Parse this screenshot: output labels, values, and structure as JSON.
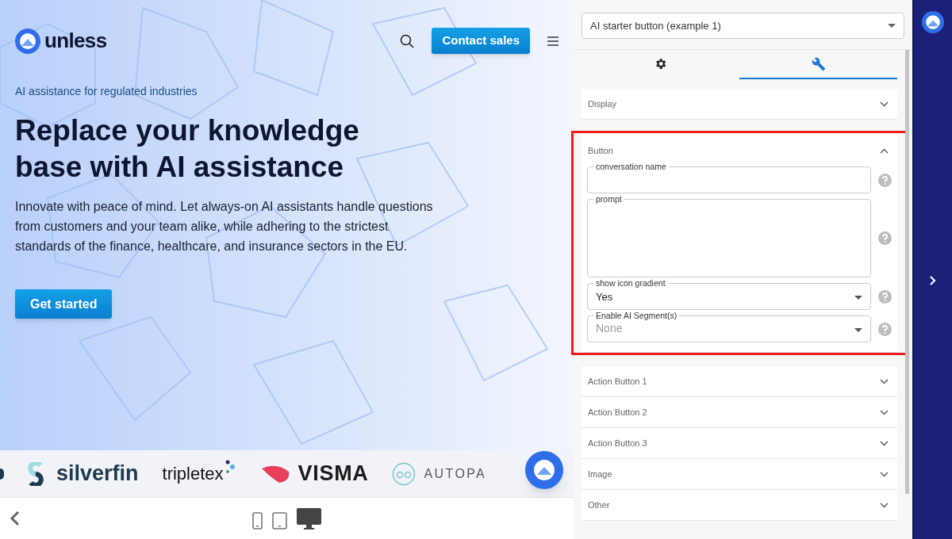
{
  "preview": {
    "logo": "unless",
    "contact_button": "Contact sales",
    "eyebrow": "AI assistance for regulated industries",
    "headline": "Replace your knowledge base with AI assistance",
    "body": "Innovate with peace of mind. Let always-on AI assistants handle questions from customers and your team alike, while adhering to the strictest standards of the finance, healthcare, and insurance sectors in the EU.",
    "cta": "Get started",
    "logos": [
      {
        "kind": "silverfin",
        "text": "silverfin"
      },
      {
        "kind": "tripletex",
        "text": "tripletex"
      },
      {
        "kind": "visma",
        "text": "VISMA"
      },
      {
        "kind": "autopay",
        "text": "AUTOPA"
      }
    ]
  },
  "device_bar": {
    "devices": [
      {
        "kind": "phone",
        "selected": false
      },
      {
        "kind": "tablet",
        "selected": false
      },
      {
        "kind": "desktop",
        "selected": true
      }
    ]
  },
  "editor": {
    "component_select": "AI starter button (example 1)",
    "tabs": [
      {
        "kind": "settings",
        "selected": false
      },
      {
        "kind": "style",
        "selected": true
      }
    ],
    "sections": [
      {
        "title": "Display",
        "expanded": false,
        "highlighted": false
      },
      {
        "title": "Button",
        "expanded": true,
        "highlighted": true,
        "fields": [
          {
            "kind": "text",
            "label": "conversation name"
          },
          {
            "kind": "textarea",
            "label": "prompt"
          },
          {
            "kind": "select",
            "label": "show icon gradient",
            "value": "Yes"
          },
          {
            "kind": "select",
            "label": "Enable AI Segment(s)",
            "placeholder": "None"
          }
        ]
      },
      {
        "title": "Action Button 1",
        "expanded": false,
        "highlighted": false
      },
      {
        "title": "Action Button 2",
        "expanded": false,
        "highlighted": false
      },
      {
        "title": "Action Button 3",
        "expanded": false,
        "highlighted": false
      },
      {
        "title": "Image",
        "expanded": false,
        "highlighted": false
      },
      {
        "title": "Other",
        "expanded": false,
        "highlighted": false
      }
    ]
  }
}
